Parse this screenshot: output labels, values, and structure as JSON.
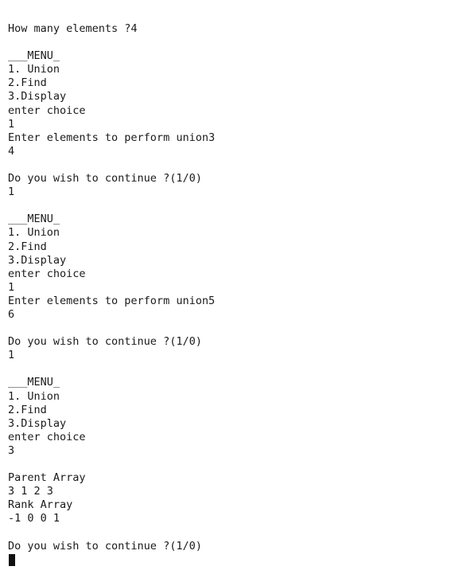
{
  "terminal": {
    "lines": [
      "How many elements ?4",
      "",
      "___MENU_",
      "1. Union",
      "2.Find",
      "3.Display",
      "enter choice",
      "1",
      "Enter elements to perform union3",
      "4",
      "",
      "Do you wish to continue ?(1/0)",
      "1",
      "",
      "___MENU_",
      "1. Union",
      "2.Find",
      "3.Display",
      "enter choice",
      "1",
      "Enter elements to perform union5",
      "6",
      "",
      "Do you wish to continue ?(1/0)",
      "1",
      "",
      "___MENU_",
      "1. Union",
      "2.Find",
      "3.Display",
      "enter choice",
      "3",
      "",
      "Parent Array",
      "3 1 2 3",
      "Rank Array",
      "-1 0 0 1",
      "",
      "Do you wish to continue ?(1/0)"
    ]
  }
}
